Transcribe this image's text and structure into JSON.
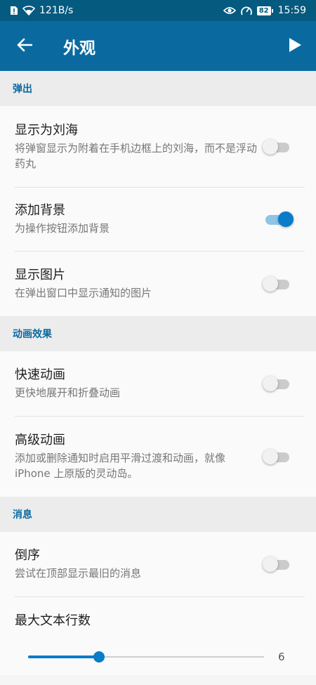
{
  "status_bar": {
    "speed": "121B/s",
    "battery": "82",
    "time": "15:59"
  },
  "header": {
    "title": "外观"
  },
  "sections": [
    {
      "title": "弹出",
      "items": [
        {
          "title": "显示为刘海",
          "subtitle": "将弹窗显示为附着在手机边框上的刘海，而不是浮动药丸",
          "toggle": false
        },
        {
          "title": "添加背景",
          "subtitle": "为操作按钮添加背景",
          "toggle": true
        },
        {
          "title": "显示图片",
          "subtitle": "在弹出窗口中显示通知的图片",
          "toggle": false
        }
      ]
    },
    {
      "title": "动画效果",
      "items": [
        {
          "title": "快速动画",
          "subtitle": "更快地展开和折叠动画",
          "toggle": false
        },
        {
          "title": "高级动画",
          "subtitle": "添加或删除通知时启用平滑过渡和动画，就像 iPhone 上原版的灵动岛。",
          "toggle": false
        }
      ]
    },
    {
      "title": "消息",
      "items": [
        {
          "title": "倒序",
          "subtitle": "尝试在顶部显示最旧的消息",
          "toggle": false
        }
      ],
      "slider": {
        "title": "最大文本行数",
        "value": "6",
        "fraction": 0.3
      }
    }
  ],
  "colors": {
    "status_bar": "#055a80",
    "app_bar": "#0a6aa0",
    "accent": "#0a7cc8"
  },
  "icons": {
    "back": "arrow-left",
    "action": "play"
  }
}
